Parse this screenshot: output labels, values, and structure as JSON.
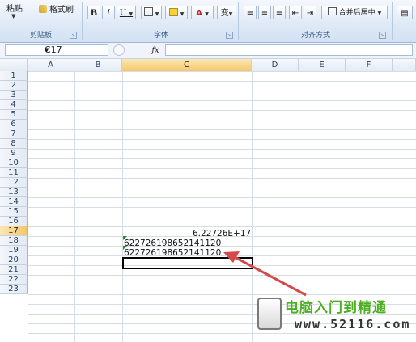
{
  "ribbon": {
    "clipboard": {
      "paste_label": "粘贴",
      "format_painter_label": "格式刷",
      "group_label": "剪贴板"
    },
    "font": {
      "bold": "B",
      "italic": "I",
      "underline": "U",
      "font_color": "A",
      "phonetic": "变",
      "group_label": "字体"
    },
    "alignment": {
      "merge_center_label": "合并后居中",
      "group_label": "对齐方式"
    }
  },
  "formula_bar": {
    "name_box": "C17",
    "fx_label": "fx",
    "formula": ""
  },
  "columns": [
    "A",
    "B",
    "C",
    "D",
    "E",
    "F"
  ],
  "selected_column": "C",
  "rows": [
    "1",
    "2",
    "3",
    "4",
    "5",
    "6",
    "7",
    "8",
    "9",
    "10",
    "11",
    "12",
    "13",
    "14",
    "15",
    "16",
    "17",
    "18",
    "19",
    "20",
    "21",
    "22",
    "23"
  ],
  "selected_row": "17",
  "cells": {
    "c14": "6.22726E+17",
    "c15": "622726198652141120",
    "c16": "622726198652141120"
  },
  "watermark": {
    "title": "电脑入门到精通",
    "url": "www.52116.com"
  },
  "colors": {
    "accent_arrow": "#d24a4a",
    "error_triangle": "#2f8a2f",
    "watermark_green": "#4caf22"
  }
}
